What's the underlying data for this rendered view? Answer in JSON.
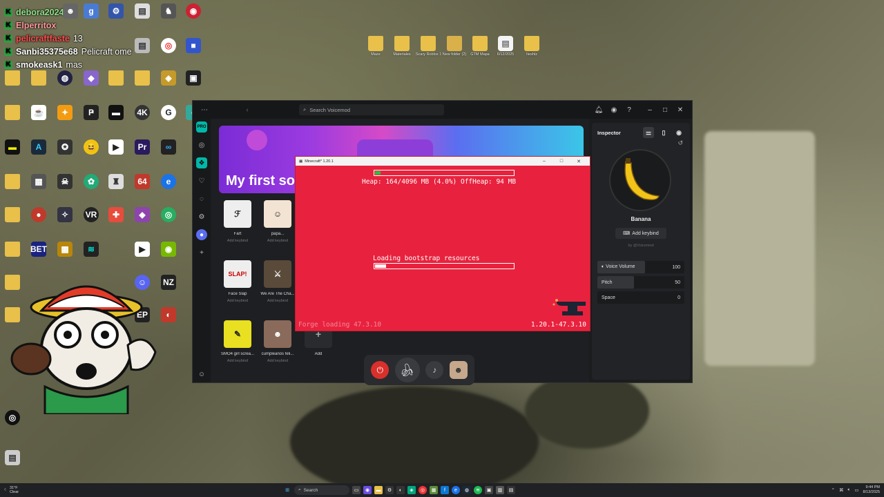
{
  "chat": [
    {
      "user": "debora2024",
      "user_color": "#8fe38a",
      "message": ""
    },
    {
      "user": "Elperritox",
      "user_color": "#ff9a9a",
      "message": ""
    },
    {
      "user": "pelicraftfaste",
      "user_color": "#ff4d4d",
      "message": "13"
    },
    {
      "user": "Sanbi35375e68",
      "user_color": "#ffffff",
      "message": "Pelicraft ome"
    },
    {
      "user": "smokeask1",
      "user_color": "#ffffff",
      "message": "mas"
    }
  ],
  "desktop_folders": [
    "Maze",
    "Materiales",
    "Scary Roblox 10-12-4",
    "New folder (2)",
    "GTM Mapa",
    "6/12/2025",
    "Iteshlz"
  ],
  "voicemod": {
    "search_placeholder": "Search Voicemod",
    "banner_title": "My first so",
    "tiles": [
      {
        "name": "Fart",
        "keybind": "Add keybind",
        "thumb": "ℱ"
      },
      {
        "name": "papa...",
        "keybind": "Add keybind",
        "thumb": "☺"
      },
      {
        "name": "Face Slap",
        "keybind": "Add keybind",
        "thumb": "SLAP!"
      },
      {
        "name": "We Are The Cha...",
        "keybind": "Add keybind",
        "thumb": "⚔"
      },
      {
        "name": "SMO4 girl screa...",
        "keybind": "Add keybind",
        "thumb": "✎"
      },
      {
        "name": "cumpleaños feli...",
        "keybind": "Add keybind",
        "thumb": "☻"
      },
      {
        "name": "Add",
        "keybind": "",
        "thumb": "+"
      }
    ],
    "inspector": {
      "title": "Inspector",
      "voice_name": "Banana",
      "add_keybind": "Add keybind",
      "by": "by @Voicemod",
      "params": [
        {
          "label": "Voice Volume",
          "value": "100",
          "fill": 0.55
        },
        {
          "label": "Pitch",
          "value": "50",
          "fill": 0.42
        },
        {
          "label": "Space",
          "value": "0",
          "fill": 0.0
        }
      ]
    }
  },
  "minecraft": {
    "title": "Minecraft* 1.20.1",
    "heap": "Heap: 164/4096 MB (4.0%) OffHeap: 94 MB",
    "heap_fraction": 0.04,
    "loading": "Loading bootstrap resources",
    "loading_fraction": 0.08,
    "footer_left": "Forge loading 47.3.10",
    "footer_right": "1.20.1-47.3.10"
  },
  "taskbar": {
    "temp": "31°F",
    "weather": "Clear",
    "search": "Search",
    "time": "9:44 PM",
    "date": "8/13/2025"
  },
  "colors": {
    "accent": "#00d6c6",
    "minecraft_red": "#e8223e",
    "voicemod_bg": "#1b1c1e"
  }
}
